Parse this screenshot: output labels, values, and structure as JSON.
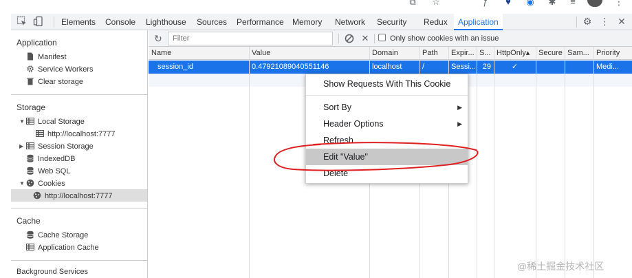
{
  "devtools": {
    "tabs": [
      "Elements",
      "Console",
      "Lighthouse",
      "Sources",
      "Performance",
      "Memory",
      "Network",
      "Security",
      "Redux",
      "Application"
    ],
    "active_tab": "Application",
    "accent_color": "#1a73e8"
  },
  "sidebar": {
    "application_title": "Application",
    "application_items": [
      "Manifest",
      "Service Workers",
      "Clear storage"
    ],
    "storage_title": "Storage",
    "local_storage": "Local Storage",
    "local_storage_origin": "http://localhost:7777",
    "session_storage": "Session Storage",
    "indexeddb": "IndexedDB",
    "websql": "Web SQL",
    "cookies": "Cookies",
    "cookies_origin": "http://localhost:7777",
    "cache_title": "Cache",
    "cache_storage": "Cache Storage",
    "application_cache": "Application Cache",
    "background_title": "Background Services"
  },
  "filter_bar": {
    "placeholder": "Filter",
    "only_issue_label": "Only show cookies with an issue"
  },
  "table": {
    "columns": [
      "Name",
      "Value",
      "Domain",
      "Path",
      "Expir...",
      "S...",
      "HttpOnly▴",
      "Secure",
      "Sam...",
      "Priority"
    ],
    "row": {
      "name": "session_id",
      "value": "0.47921089040551146",
      "domain": "localhost",
      "path": "/",
      "expires": "Sessi...",
      "size": "29",
      "httponly": "✓",
      "secure": "",
      "samesite": "",
      "priority": "Medi..."
    }
  },
  "context_menu": {
    "items": [
      "Show Requests With This Cookie",
      "Sort By",
      "Header Options",
      "Refresh",
      "Edit \"Value\"",
      "Delete"
    ],
    "highlighted": "Edit \"Value\""
  },
  "annotation_color": "#e02020",
  "watermark": "@稀土掘金技术社区"
}
